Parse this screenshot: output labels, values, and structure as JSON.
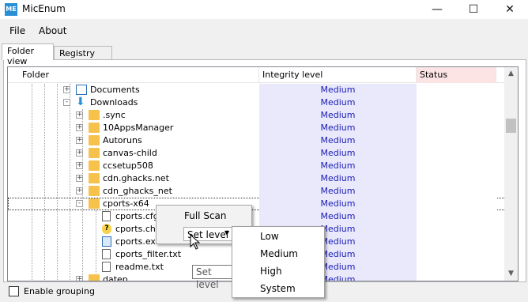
{
  "window": {
    "title": "MicEnum",
    "icon_label": "ME"
  },
  "menu": [
    "File",
    "About"
  ],
  "tabs": [
    {
      "label": "Folder view",
      "active": true
    },
    {
      "label": "Registry view",
      "active": false
    }
  ],
  "columns": {
    "folder": "Folder",
    "integrity": "Integrity level",
    "status": "Status"
  },
  "rows": [
    {
      "name": "Documents",
      "integrity": "Medium",
      "icon": "document-icon",
      "expander": "+"
    },
    {
      "name": "Downloads",
      "integrity": "Medium",
      "icon": "download-arrow-icon",
      "expander": "-"
    },
    {
      "name": ".sync",
      "integrity": "Medium",
      "icon": "folder-icon",
      "expander": "+"
    },
    {
      "name": "10AppsManager",
      "integrity": "Medium",
      "icon": "folder-icon",
      "expander": "+"
    },
    {
      "name": "Autoruns",
      "integrity": "Medium",
      "icon": "folder-icon",
      "expander": "+"
    },
    {
      "name": "canvas-child",
      "integrity": "Medium",
      "icon": "folder-icon",
      "expander": "+"
    },
    {
      "name": "ccsetup508",
      "integrity": "Medium",
      "icon": "folder-icon",
      "expander": "+"
    },
    {
      "name": "cdn.ghacks.net",
      "integrity": "Medium",
      "icon": "folder-icon",
      "expander": "+"
    },
    {
      "name": "cdn_ghacks_net",
      "integrity": "Medium",
      "icon": "folder-icon",
      "expander": "+"
    },
    {
      "name": "cports-x64",
      "integrity": "Medium",
      "icon": "folder-icon",
      "expander": "-",
      "selected": true
    },
    {
      "name": "cports.cfg",
      "integrity": "Medium",
      "icon": "file-icon"
    },
    {
      "name": "cports.chm",
      "integrity": "Medium",
      "icon": "help-file-icon"
    },
    {
      "name": "cports.exe",
      "integrity": "Medium",
      "icon": "exe-icon"
    },
    {
      "name": "cports_filter.txt",
      "integrity": "Medium",
      "icon": "text-file-icon"
    },
    {
      "name": "readme.txt",
      "integrity": "Medium",
      "icon": "text-file-icon"
    },
    {
      "name": "datep",
      "integrity": "Medium",
      "icon": "folder-icon",
      "expander": "+"
    }
  ],
  "footer": {
    "grouping_label": "Enable grouping",
    "grouping_checked": false
  },
  "context_menu": {
    "full_scan": "Full Scan",
    "set_level": "Set level"
  },
  "tooltip": "Set level",
  "level_menu": [
    "Low",
    "Medium",
    "High",
    "System"
  ]
}
